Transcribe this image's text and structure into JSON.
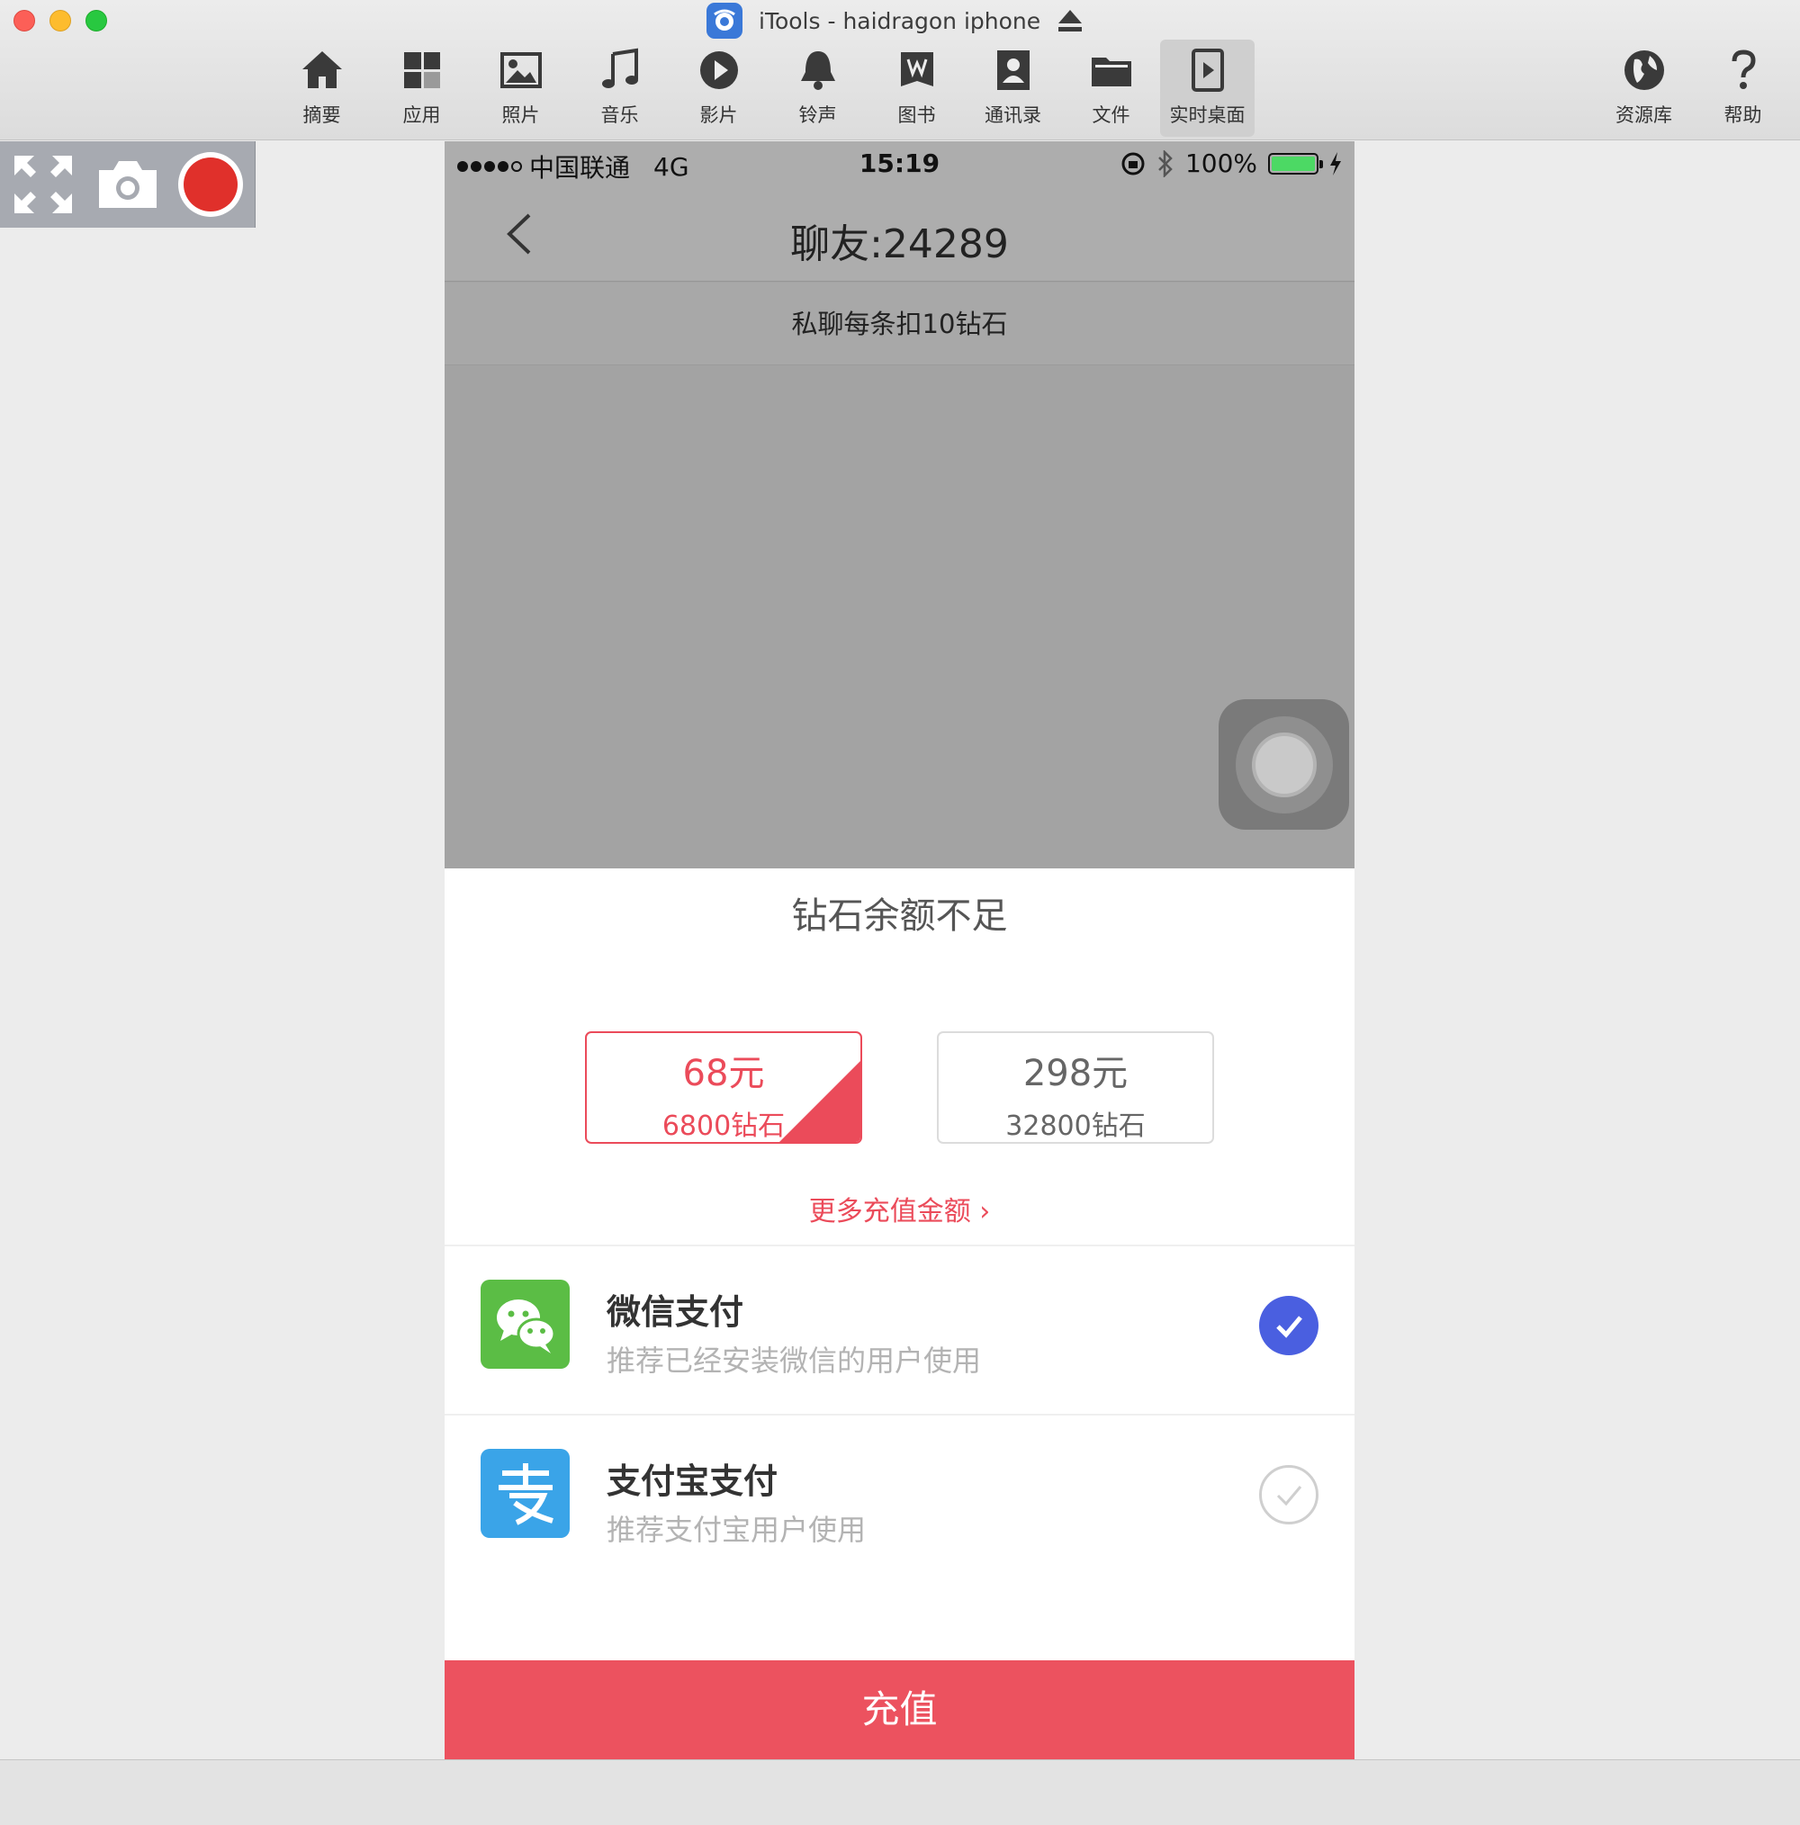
{
  "window": {
    "title": "iTools - haidragon iphone"
  },
  "toolbar": {
    "items": [
      {
        "label": "摘要",
        "icon": "home-icon"
      },
      {
        "label": "应用",
        "icon": "apps-icon"
      },
      {
        "label": "照片",
        "icon": "photo-icon"
      },
      {
        "label": "音乐",
        "icon": "music-icon"
      },
      {
        "label": "影片",
        "icon": "play-icon"
      },
      {
        "label": "铃声",
        "icon": "bell-icon"
      },
      {
        "label": "图书",
        "icon": "book-icon"
      },
      {
        "label": "通讯录",
        "icon": "contacts-icon"
      },
      {
        "label": "文件",
        "icon": "folder-icon"
      },
      {
        "label": "实时桌面",
        "icon": "live-desktop-icon",
        "active": true
      }
    ],
    "right_items": [
      {
        "label": "资源库",
        "icon": "globe-icon"
      },
      {
        "label": "帮助",
        "icon": "help-icon"
      }
    ]
  },
  "controls": [
    "fullscreen-icon",
    "camera-icon",
    "record-icon"
  ],
  "phone": {
    "status": {
      "carrier": "中国联通",
      "network": "4G",
      "time": "15:19",
      "battery": "100%"
    },
    "nav_title": "聊友:24289",
    "notice": "私聊每条扣10钻石",
    "sheet": {
      "title": "钻石余额不足",
      "options": [
        {
          "price": "68元",
          "amount": "6800钻石",
          "selected": true
        },
        {
          "price": "298元",
          "amount": "32800钻石",
          "selected": false
        }
      ],
      "more": "更多充值金额 ›",
      "payments": [
        {
          "name": "微信支付",
          "desc": "推荐已经安装微信的用户使用",
          "selected": true
        },
        {
          "name": "支付宝支付",
          "desc": "推荐支付宝用户使用",
          "selected": false
        }
      ],
      "button": "充值"
    }
  },
  "colors": {
    "accent": "#eb4b5a",
    "wechat": "#5bbd45",
    "alipay": "#3aa4e8",
    "check": "#4a5fe0"
  }
}
